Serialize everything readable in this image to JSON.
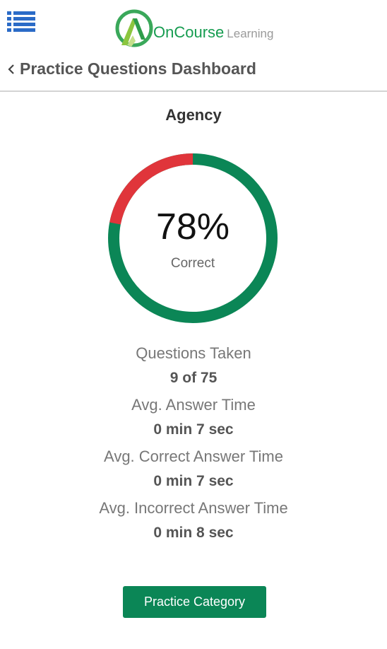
{
  "header": {
    "logo": {
      "brand": "OnCourse",
      "sub": "Learning"
    },
    "back_title": "Practice Questions Dashboard"
  },
  "category": {
    "title": "Agency"
  },
  "score": {
    "percent_text": "78%",
    "percent_value": 78,
    "label": "Correct"
  },
  "stats": [
    {
      "label": "Questions Taken",
      "value": "9 of 75"
    },
    {
      "label": "Avg. Answer Time",
      "value": "0 min 7 sec"
    },
    {
      "label": "Avg. Correct Answer Time",
      "value": "0 min 7 sec"
    },
    {
      "label": "Avg. Incorrect Answer Time",
      "value": "0 min 8 sec"
    }
  ],
  "button": {
    "label": "Practice Category"
  },
  "colors": {
    "correct": "#0b8656",
    "incorrect": "#e0353b",
    "menu": "#2b6bc7",
    "brand_green": "#169c50"
  },
  "icons": {
    "menu": "list-menu-icon",
    "back": "chevron-left-icon"
  }
}
